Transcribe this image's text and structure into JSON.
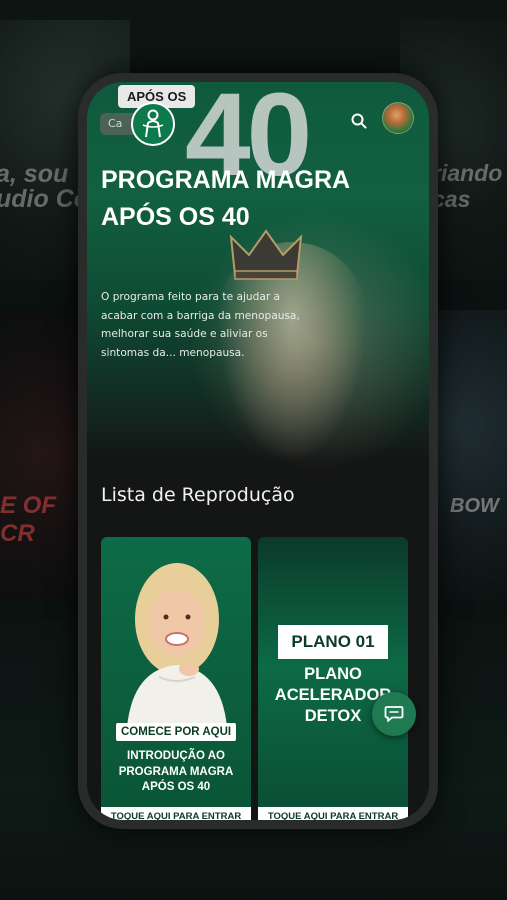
{
  "background": {
    "left_text_top": "a, sou\nudio Cou",
    "right_text_top": "riando\ncas",
    "left_text_mid": "E OF\nCR",
    "right_text_mid": "BOW"
  },
  "header": {
    "tag_label": "APÓS OS",
    "category_pill": "Ca",
    "big_number": "40",
    "logo_icon": "woman-silhouette-icon",
    "search_icon": "search-icon"
  },
  "hero": {
    "title": "PROGRAMA MAGRA APÓS OS 40",
    "description": "O programa feito para te ajudar a acabar com a barriga da menopausa, melhorar sua saúde e aliviar os sintomas da... menopausa."
  },
  "playlist": {
    "section_title": "Lista de Reprodução",
    "cards": [
      {
        "badge": "COMECE POR AQUI",
        "caption": "INTRODUÇÃO AO PROGRAMA MAGRA APÓS OS 40",
        "footer": "TOQUE AQUI PARA ENTRAR"
      },
      {
        "badge": "PLANO 01",
        "caption": "PLANO ACELERADOR DETOX",
        "footer": "TOQUE AQUI PARA ENTRAR"
      }
    ]
  },
  "chat": {
    "icon": "chat-bubble-icon"
  },
  "colors": {
    "brand_green": "#0c7a4b",
    "dark": "#141515",
    "white": "#ffffff"
  }
}
